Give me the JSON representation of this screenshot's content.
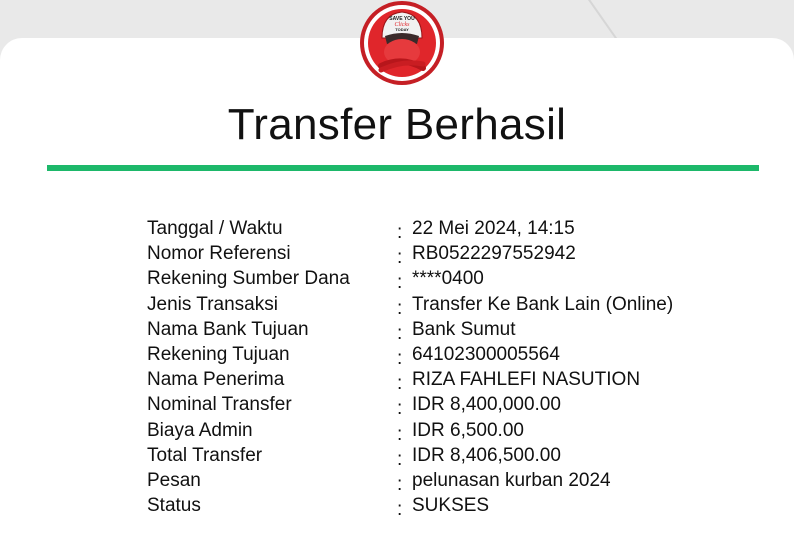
{
  "logo": {
    "line1": "SAVE YOU",
    "line2": "Clicks",
    "line3": "TODAY"
  },
  "title": "Transfer Berhasil",
  "details": [
    {
      "label": "Tanggal / Waktu",
      "value": "22 Mei 2024, 14:15"
    },
    {
      "label": "Nomor Referensi",
      "value": "RB0522297552942"
    },
    {
      "label": "Rekening Sumber Dana",
      "value": "****0400"
    },
    {
      "label": "Jenis Transaksi",
      "value": "Transfer Ke Bank Lain (Online)"
    },
    {
      "label": "Nama Bank Tujuan",
      "value": "Bank Sumut"
    },
    {
      "label": "Rekening Tujuan",
      "value": "64102300005564"
    },
    {
      "label": "Nama Penerima",
      "value": "RIZA FAHLEFI NASUTION"
    },
    {
      "label": "Nominal Transfer",
      "value": "IDR 8,400,000.00"
    },
    {
      "label": "Biaya Admin",
      "value": "IDR 6,500.00"
    },
    {
      "label": "Total Transfer",
      "value": "IDR 8,406,500.00"
    },
    {
      "label": "Pesan",
      "value": "pelunasan kurban 2024"
    },
    {
      "label": "Status",
      "value": "SUKSES"
    }
  ],
  "separator": ":",
  "colors": {
    "accent": "#1db86a",
    "mascot": "#e0262b"
  }
}
